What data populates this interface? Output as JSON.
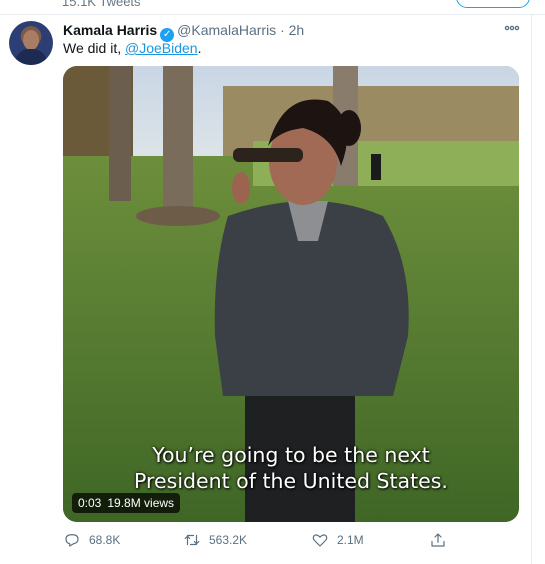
{
  "header": {
    "tweet_count": "15.1K Tweets"
  },
  "tweet": {
    "author_name": "Kamala Harris",
    "handle": "@KamalaHarris",
    "time": "2h",
    "separator": "·",
    "text_prefix": "We did it, ",
    "mention": "@JoeBiden",
    "text_suffix": ".",
    "media": {
      "caption_line1": "You’re going to be the next",
      "caption_line2": "President of the United States.",
      "duration": "0:03",
      "views": "19.8M views"
    },
    "actions": {
      "replies": "68.8K",
      "retweets": "563.2K",
      "likes": "2.1M"
    }
  },
  "icons": {
    "verified": "verified-badge-icon",
    "more": "more-options-icon",
    "reply": "reply-icon",
    "retweet": "retweet-icon",
    "like": "heart-icon",
    "share": "share-icon"
  },
  "colors": {
    "accent": "#1da1f2",
    "link": "#1b95e0",
    "muted": "#5b7083"
  }
}
